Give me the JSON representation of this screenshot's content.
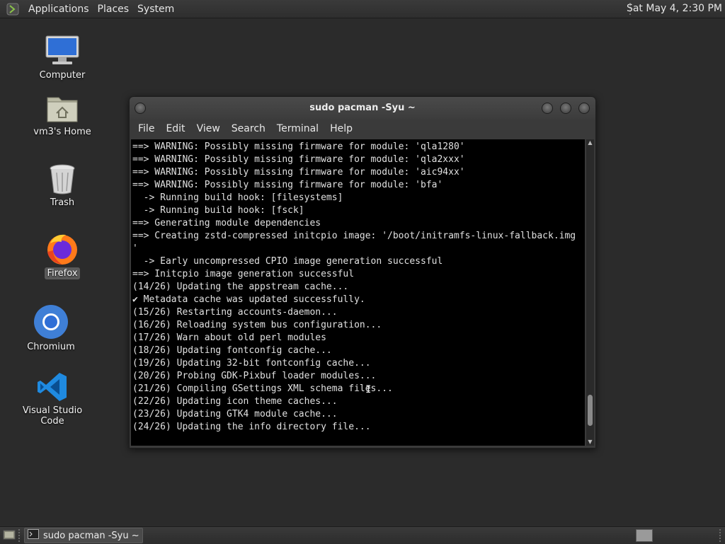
{
  "top_panel": {
    "menus": [
      "Applications",
      "Places",
      "System"
    ],
    "clock": "Sat May  4,  2:30 PM"
  },
  "desktop": {
    "icons": [
      {
        "label": "Computer",
        "icon": "computer-icon"
      },
      {
        "label": "vm3's Home",
        "icon": "home-folder-icon"
      },
      {
        "label": "Trash",
        "icon": "trash-icon"
      },
      {
        "label": "Firefox",
        "icon": "firefox-icon",
        "selected": true
      },
      {
        "label": "Chromium",
        "icon": "chromium-icon"
      },
      {
        "label": "Visual Studio Code",
        "icon": "vscode-icon"
      }
    ]
  },
  "window": {
    "title": "sudo pacman -Syu ~",
    "menu": [
      "File",
      "Edit",
      "View",
      "Search",
      "Terminal",
      "Help"
    ],
    "terminal_lines": [
      "==> WARNING: Possibly missing firmware for module: 'qla1280'",
      "==> WARNING: Possibly missing firmware for module: 'qla2xxx'",
      "==> WARNING: Possibly missing firmware for module: 'aic94xx'",
      "==> WARNING: Possibly missing firmware for module: 'bfa'",
      "  -> Running build hook: [filesystems]",
      "  -> Running build hook: [fsck]",
      "==> Generating module dependencies",
      "==> Creating zstd-compressed initcpio image: '/boot/initramfs-linux-fallback.img",
      "'",
      "  -> Early uncompressed CPIO image generation successful",
      "==> Initcpio image generation successful",
      "(14/26) Updating the appstream cache...",
      "✔ Metadata cache was updated successfully.",
      "(15/26) Restarting accounts-daemon...",
      "(16/26) Reloading system bus configuration...",
      "(17/26) Warn about old perl modules",
      "(18/26) Updating fontconfig cache...",
      "(19/26) Updating 32-bit fontconfig cache...",
      "(20/26) Probing GDK-Pixbuf loader modules...",
      "(21/26) Compiling GSettings XML schema files...",
      "(22/26) Updating icon theme caches...",
      "(23/26) Updating GTK4 module cache...",
      "(24/26) Updating the info directory file..."
    ],
    "scroll_position": 0.95
  },
  "taskbar": {
    "task_label": "sudo pacman -Syu ~"
  },
  "colors": {
    "desktop_bg": "#2b2b2b",
    "panel_bg": "#333333",
    "terminal_bg": "#000000",
    "terminal_fg": "#e0e0e0"
  }
}
